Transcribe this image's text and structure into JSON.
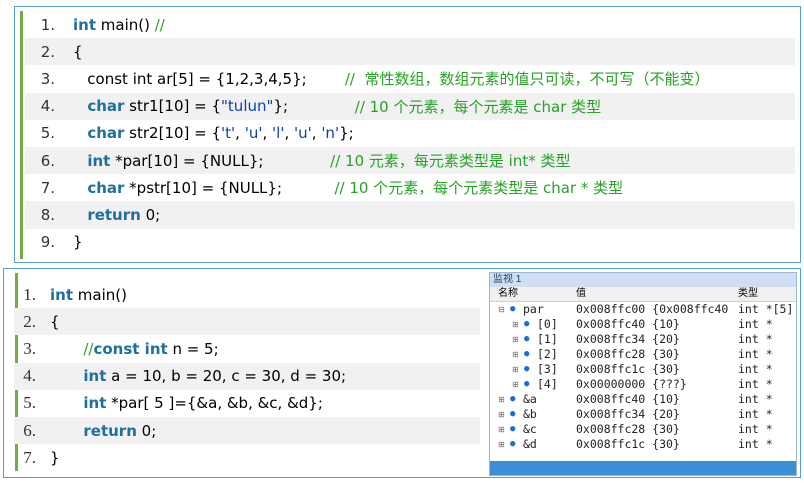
{
  "panel1": {
    "lines": [
      {
        "n": "1.",
        "segs": [
          {
            "t": "int",
            "c": "kw"
          },
          {
            "t": " main() ",
            "c": ""
          },
          {
            "t": "//",
            "c": "cmt"
          }
        ]
      },
      {
        "n": "2.",
        "segs": [
          {
            "t": "{",
            "c": ""
          }
        ]
      },
      {
        "n": "3.",
        "segs": [
          {
            "t": "   const int ar[5] = {1,2,3,4,5};        ",
            "c": ""
          },
          {
            "t": "//  常性数组，数组元素的值只可读，不可写（不能变）",
            "c": "cmt"
          }
        ]
      },
      {
        "n": "4.",
        "segs": [
          {
            "t": "   ",
            "c": ""
          },
          {
            "t": "char",
            "c": "kw"
          },
          {
            "t": " str1[10] = {",
            "c": ""
          },
          {
            "t": "\"tulun\"",
            "c": "str"
          },
          {
            "t": "};              ",
            "c": ""
          },
          {
            "t": "// 10 个元素，每个元素是 char 类型",
            "c": "cmt"
          }
        ]
      },
      {
        "n": "5.",
        "segs": [
          {
            "t": "   ",
            "c": ""
          },
          {
            "t": "char",
            "c": "kw"
          },
          {
            "t": " str2[10] = {",
            "c": ""
          },
          {
            "t": "'t'",
            "c": "str"
          },
          {
            "t": ", ",
            "c": ""
          },
          {
            "t": "'u'",
            "c": "str"
          },
          {
            "t": ", ",
            "c": ""
          },
          {
            "t": "'l'",
            "c": "str"
          },
          {
            "t": ", ",
            "c": ""
          },
          {
            "t": "'u'",
            "c": "str"
          },
          {
            "t": ", ",
            "c": ""
          },
          {
            "t": "'n'",
            "c": "str"
          },
          {
            "t": "};",
            "c": ""
          }
        ]
      },
      {
        "n": "6.",
        "segs": [
          {
            "t": "   ",
            "c": ""
          },
          {
            "t": "int",
            "c": "kw"
          },
          {
            "t": " *par[10] = {NULL};              ",
            "c": ""
          },
          {
            "t": "// 10 元素，每元素类型是 int* 类型",
            "c": "cmt"
          }
        ]
      },
      {
        "n": "7.",
        "segs": [
          {
            "t": "   ",
            "c": ""
          },
          {
            "t": "char",
            "c": "kw"
          },
          {
            "t": " *pstr[10] = {NULL};           ",
            "c": ""
          },
          {
            "t": "// 10 个元素，每个元素类型是 char * 类型",
            "c": "cmt"
          }
        ]
      },
      {
        "n": "8.",
        "segs": [
          {
            "t": "   ",
            "c": ""
          },
          {
            "t": "return",
            "c": "kw"
          },
          {
            "t": " 0;",
            "c": ""
          }
        ]
      },
      {
        "n": "9.",
        "segs": [
          {
            "t": "}",
            "c": ""
          }
        ]
      }
    ]
  },
  "panel2": {
    "lines": [
      {
        "n": "1.",
        "segs": [
          {
            "t": "int",
            "c": "kw"
          },
          {
            "t": " main()",
            "c": ""
          }
        ]
      },
      {
        "n": "2.",
        "segs": [
          {
            "t": "{",
            "c": ""
          }
        ]
      },
      {
        "n": "3.",
        "segs": [
          {
            "t": "       //",
            "c": "cmt2"
          },
          {
            "t": "const int",
            "c": "kw"
          },
          {
            "t": " n = 5;",
            "c": ""
          }
        ]
      },
      {
        "n": "4.",
        "segs": [
          {
            "t": "       ",
            "c": ""
          },
          {
            "t": "int",
            "c": "kw"
          },
          {
            "t": " a = 10, b = 20, c = 30, d = 30;",
            "c": ""
          }
        ]
      },
      {
        "n": "5.",
        "segs": [
          {
            "t": "       ",
            "c": ""
          },
          {
            "t": "int",
            "c": "kw"
          },
          {
            "t": " *par[ 5 ]={&a, &b, &c, &d};",
            "c": ""
          }
        ]
      },
      {
        "n": "6.",
        "segs": [
          {
            "t": "       ",
            "c": ""
          },
          {
            "t": "return",
            "c": "kw"
          },
          {
            "t": " 0;",
            "c": ""
          }
        ]
      },
      {
        "n": "7.",
        "segs": [
          {
            "t": "}",
            "c": ""
          }
        ]
      }
    ]
  },
  "watch": {
    "title": "监视 1",
    "col_name": "名称",
    "col_value": "值",
    "col_type": "类型",
    "rows": [
      {
        "exp": "⊟",
        "name": "par",
        "value": "0x008ffc00 {0x008ffc40",
        "type": "int *[5]",
        "indent": 0
      },
      {
        "exp": "⊞",
        "name": "[0]",
        "value": "0x008ffc40 {10}",
        "type": "int *",
        "indent": 1
      },
      {
        "exp": "⊞",
        "name": "[1]",
        "value": "0x008ffc34 {20}",
        "type": "int *",
        "indent": 1
      },
      {
        "exp": "⊞",
        "name": "[2]",
        "value": "0x008ffc28 {30}",
        "type": "int *",
        "indent": 1
      },
      {
        "exp": "⊞",
        "name": "[3]",
        "value": "0x008ffc1c {30}",
        "type": "int *",
        "indent": 1
      },
      {
        "exp": "⊞",
        "name": "[4]",
        "value": "0x00000000 {???}",
        "type": "int *",
        "indent": 1
      },
      {
        "exp": "⊞",
        "name": "&a",
        "value": "0x008ffc40 {10}",
        "type": "int *",
        "indent": 0
      },
      {
        "exp": "⊞",
        "name": "&b",
        "value": "0x008ffc34 {20}",
        "type": "int *",
        "indent": 0
      },
      {
        "exp": "⊞",
        "name": "&c",
        "value": "0x008ffc28 {30}",
        "type": "int *",
        "indent": 0
      },
      {
        "exp": "⊞",
        "name": "&d",
        "value": "0x008ffc1c {30}",
        "type": "int *",
        "indent": 0
      }
    ]
  },
  "colors": {
    "keyword": "#1f6f9f",
    "string": "#0b3fb3",
    "comment": "#27a127",
    "accent": "#5b9bd5",
    "bar": "#70ad47"
  }
}
